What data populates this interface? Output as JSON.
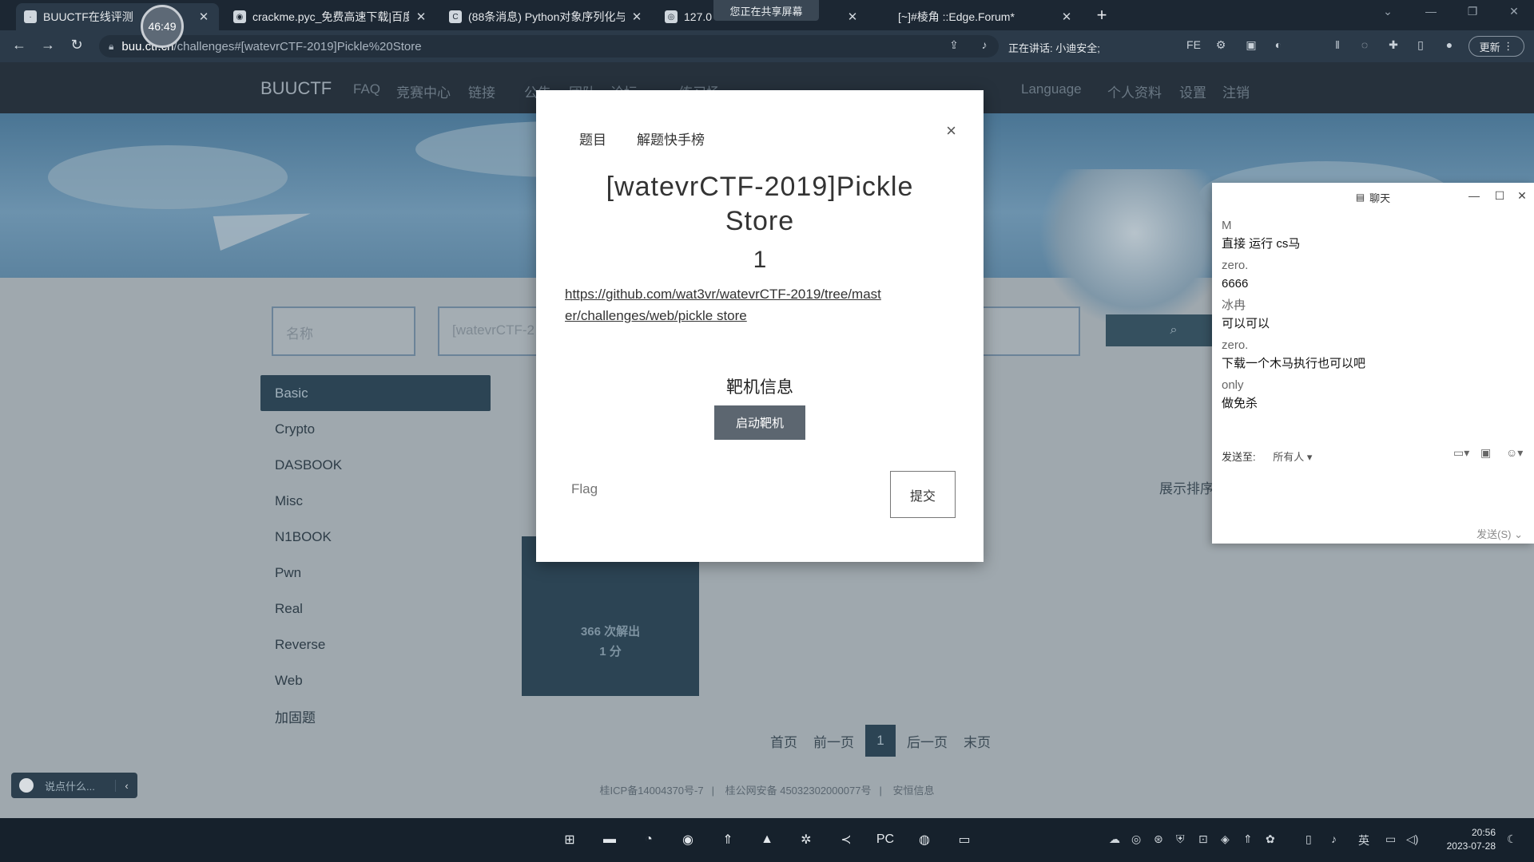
{
  "browser": {
    "tabs": [
      {
        "label": "BUUCTF在线评测",
        "active": true
      },
      {
        "label": "crackme.pyc_免费高速下载|百度",
        "active": false
      },
      {
        "label": "(88条消息) Python对象序列化与",
        "active": false
      },
      {
        "label": "127.0",
        "active": false
      },
      {
        "label": "[~]#棱角 ::Edge.Forum*",
        "active": false
      }
    ],
    "timer": "46:49",
    "sharing_banner": "您正在共享屏幕",
    "url_host": "buu.ctf.cn",
    "url_path": "/challenges#[watevrCTF-2019]Pickle%20Store",
    "speaking_label": "正在讲话:",
    "speaking_name": "小迪安全;",
    "update_label": "更新"
  },
  "site": {
    "brand": "BUUCTF",
    "nav_links": [
      "FAQ",
      "竞赛中心",
      "链接",
      "公告",
      "团队",
      "论坛",
      "练习场"
    ],
    "nav_right": [
      "Language",
      "个人资料",
      "设置",
      "注销"
    ],
    "filter_name_placeholder": "名称",
    "filter_query_value": "[watevrCTF-2",
    "categories": [
      "Basic",
      "Crypto",
      "DASBOOK",
      "Misc",
      "N1BOOK",
      "Pwn",
      "Real",
      "Reverse",
      "Web",
      "加固题"
    ],
    "active_category": "Basic",
    "card_solves": "366 次解出",
    "card_points": "1 分",
    "rank_label": "展示排序",
    "pager": [
      "首页",
      "前一页",
      "1",
      "后一页",
      "末页"
    ],
    "footer": [
      "桂ICP备14004370号-7",
      "桂公网安备 45032302000077号",
      "安恒信息"
    ],
    "chat_toggle": "说点什么..."
  },
  "modal": {
    "tabs": [
      "题目",
      "解题快手榜"
    ],
    "close": "×",
    "title": "[watevrCTF-2019]Pickle Store",
    "points": "1",
    "link": "https://github.com/wat3vr/watevrCTF-2019/tree/master/challenges/web/pickle store",
    "target_heading": "靶机信息",
    "start_button": "启动靶机",
    "flag_placeholder": "Flag",
    "submit_button": "提交"
  },
  "chat": {
    "title": "聊天",
    "messages": [
      {
        "who": "M",
        "text": "直接 运行 cs马"
      },
      {
        "who": "zero.",
        "text": "6666"
      },
      {
        "who": "冰冉",
        "text": "可以可以"
      },
      {
        "who": "zero.",
        "text": "下载一个木马执行也可以吧"
      },
      {
        "who": "only",
        "text": "做免杀"
      }
    ],
    "send_to_label": "发送至:",
    "send_to_value": "所有人",
    "send_button": "发送(S)"
  },
  "taskbar": {
    "ime": "英",
    "time": "20:56",
    "date": "2023-07-28"
  }
}
